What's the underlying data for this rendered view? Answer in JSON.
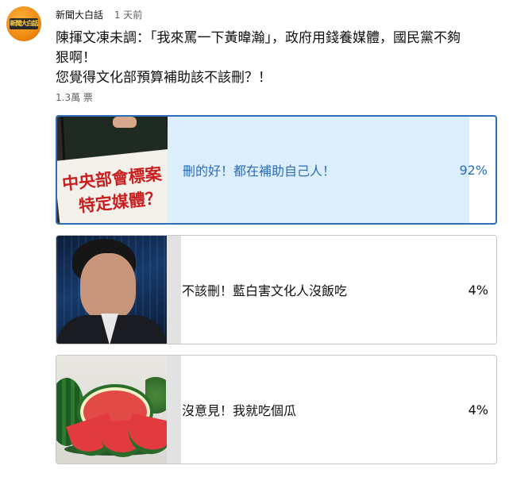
{
  "channel": {
    "name": "新聞大白話",
    "time": "1 天前",
    "avatar_text": "新聞大白話"
  },
  "post": {
    "lines": [
      "陳揮文凍未調：「我來罵一下黃暐瀚」，政府用錢養媒體，國民黨不夠",
      "狠啊！",
      "您覺得文化部預算補助該不該刪？！"
    ],
    "votes": "1.3萬 票"
  },
  "poll": {
    "options": [
      {
        "label": "刪的好！都在補助自己人！",
        "percent": "92%",
        "fill": 0.92,
        "selected": true,
        "image_text": [
          "中央部會標案",
          "特定媒體？"
        ]
      },
      {
        "label": "不該刪！藍白害文化人沒飯吃",
        "percent": "4%",
        "fill": 0.04,
        "selected": false
      },
      {
        "label": "沒意見！我就吃個瓜",
        "percent": "4%",
        "fill": 0.04,
        "selected": false
      }
    ]
  },
  "colors": {
    "accent": "#2d6db5",
    "selected_fill": "#dceefb",
    "unselected_fill": "#e2e2e2"
  }
}
